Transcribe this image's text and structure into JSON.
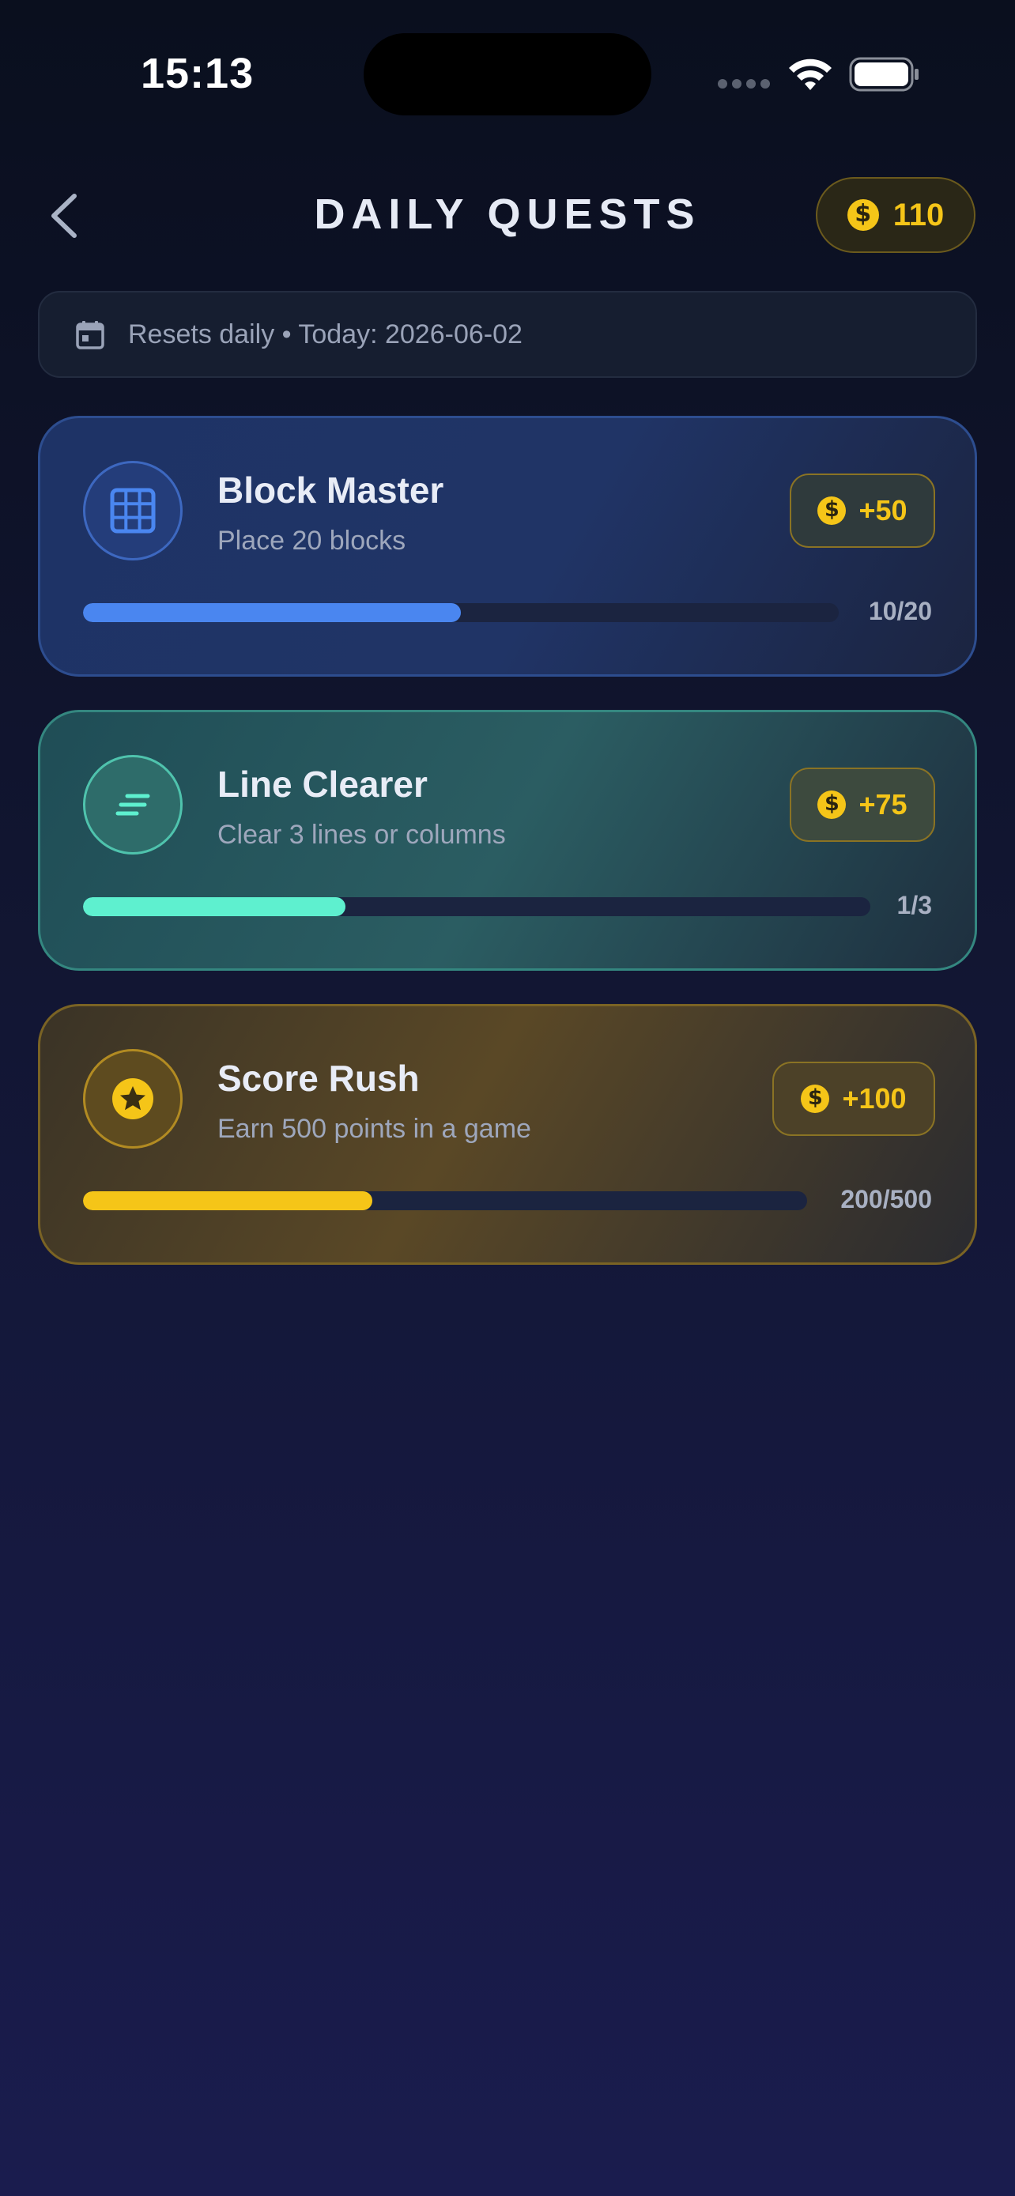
{
  "status_bar": {
    "time": "15:13"
  },
  "header": {
    "title": "DAILY QUESTS",
    "coins": "110"
  },
  "reset_bar": {
    "text": "Resets daily • Today: 2026-06-02"
  },
  "quests": [
    {
      "title": "Block Master",
      "description": "Place 20 blocks",
      "reward": "+50",
      "progress_text": "10/20",
      "progress": 0.5,
      "icon": "grid-icon",
      "accent": "#4a86f0"
    },
    {
      "title": "Line Clearer",
      "description": "Clear 3 lines or columns",
      "reward": "+75",
      "progress_text": "1/3",
      "progress": 0.3333,
      "icon": "lines-icon",
      "accent": "#5ef0cf"
    },
    {
      "title": "Score Rush",
      "description": "Earn 500 points in a game",
      "reward": "+100",
      "progress_text": "200/500",
      "progress": 0.4,
      "icon": "star-icon",
      "accent": "#f5c518"
    }
  ],
  "colors": {
    "coin": "#f5c518",
    "background_top": "#0a0f1e",
    "background_bottom": "#1a1c4e"
  }
}
